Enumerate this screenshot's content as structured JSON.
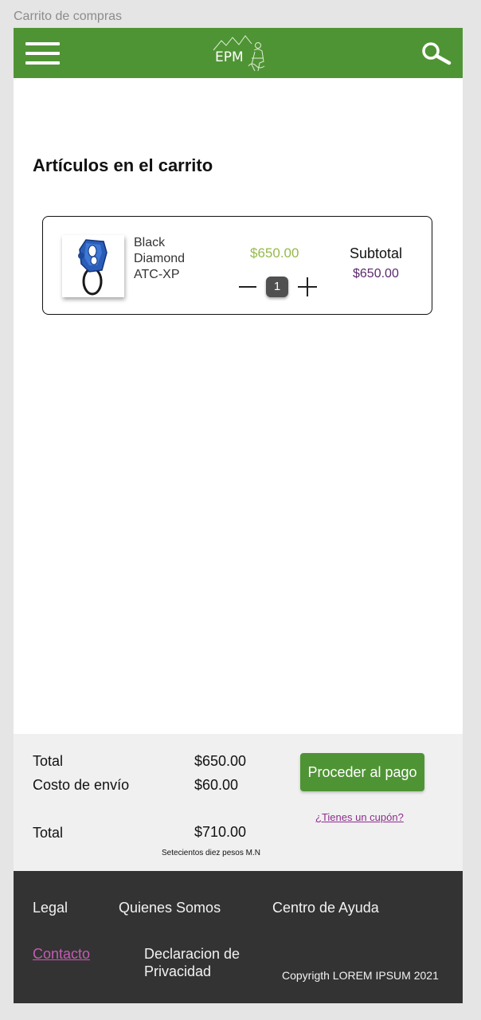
{
  "frame": {
    "title": "Carrito de compras"
  },
  "navbar": {
    "logo_text": "EPM",
    "menu_icon": "hamburger-menu-icon",
    "search_icon": "search-icon",
    "color": "#4f9434"
  },
  "cart": {
    "title": "Artículos en el carrito",
    "items": [
      {
        "name": "Black\nDiamond\nATC-XP",
        "image": "belay-device-image",
        "unit_price": "$650.00",
        "quantity": "1",
        "subtotal_label": "Subtotal",
        "subtotal": "$650.00"
      }
    ]
  },
  "summary": {
    "total_label": "Total",
    "total_value": "$650.00",
    "shipping_label": "Costo de envío",
    "shipping_value": "$60.00",
    "grand_total_label": "Total",
    "grand_total_value": "$710.00",
    "amount_in_words": "Setecientos diez pesos M.N",
    "checkout_label": "Proceder al pago",
    "coupon_label": "¿Tienes un cupón?"
  },
  "footer": {
    "legal": "Legal",
    "about": "Quienes Somos",
    "help": "Centro de Ayuda",
    "contact": "Contacto",
    "privacy": "Declaracion de\nPrivacidad",
    "copyright": "Copyrigth LOREM IPSUM 2021"
  },
  "colors": {
    "brand_green": "#4f9434",
    "price_green": "#96b94a",
    "subtotal_purple": "#5a2a6b",
    "link_purple": "#8e2c8e",
    "footer_bg": "#333333"
  }
}
